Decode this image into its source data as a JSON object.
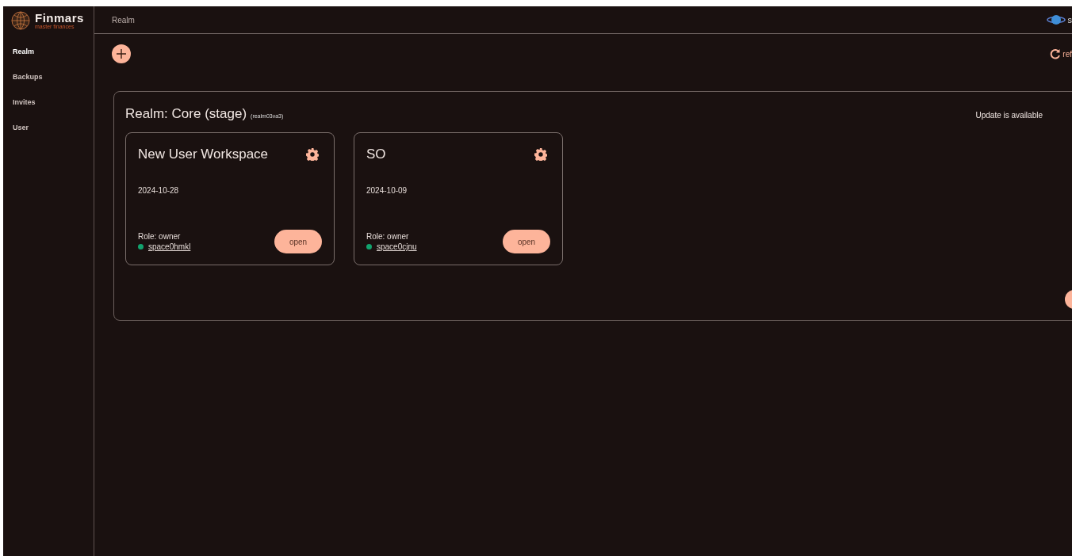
{
  "logo": {
    "name": "Finmars",
    "tagline": "master finances"
  },
  "sidebar": {
    "items": [
      {
        "label": "Realm",
        "selected": true
      },
      {
        "label": "Backups",
        "selected": false
      },
      {
        "label": "Invites",
        "selected": false
      },
      {
        "label": "User",
        "selected": false
      }
    ]
  },
  "header": {
    "title": "Realm",
    "user": "s"
  },
  "toolbar": {
    "refresh": "ref"
  },
  "realm": {
    "title": "Realm: Core (stage)",
    "code": "(realm03va3)",
    "update_notice": "Update is available",
    "workspaces": [
      {
        "name": "New User Workspace",
        "date": "2024-10-28",
        "role": "Role: owner",
        "space": "space0hmkl",
        "color": "#12a36e",
        "action": "open"
      },
      {
        "name": "SO",
        "date": "2024-10-09",
        "role": "Role: owner",
        "space": "space0cjnu",
        "color": "#12a36e",
        "action": "open"
      }
    ]
  }
}
